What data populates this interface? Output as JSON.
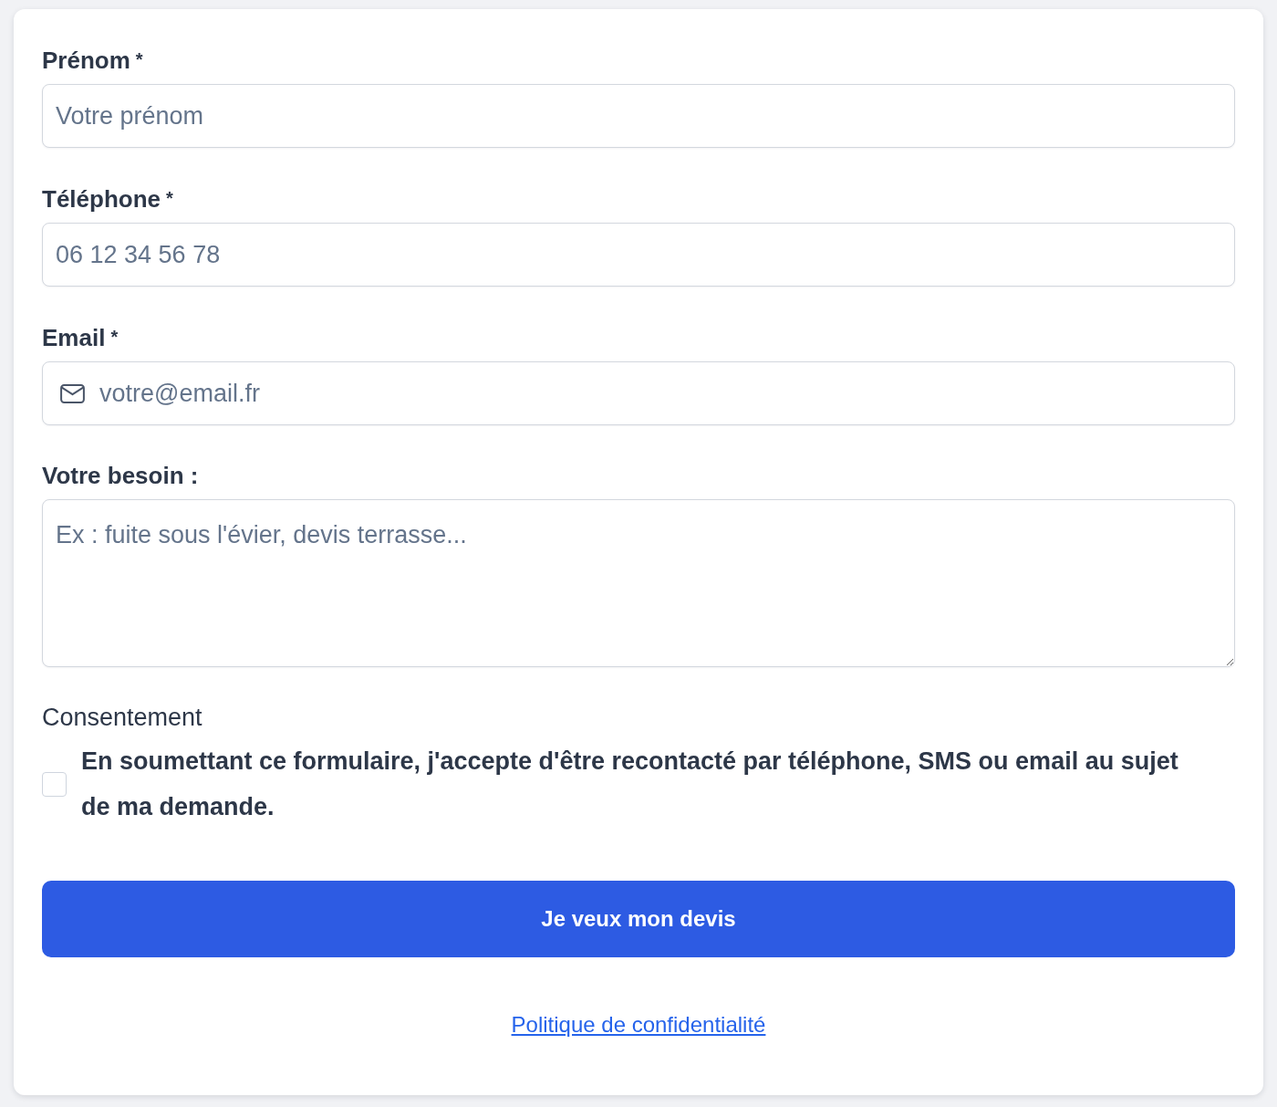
{
  "fields": [
    {
      "kind": "text",
      "label": "Prénom",
      "required_mark": "*",
      "placeholder": "Votre prénom"
    },
    {
      "kind": "tel",
      "label": "Téléphone",
      "required_mark": "*",
      "placeholder": "06 12 34 56 78"
    },
    {
      "kind": "email",
      "label": "Email",
      "required_mark": "*",
      "placeholder": "votre@email.fr"
    },
    {
      "kind": "textarea",
      "label": "Votre besoin :",
      "placeholder": "Ex : fuite sous l'évier, devis terrasse..."
    }
  ],
  "consent": {
    "heading": "Consentement",
    "checked": false,
    "text": "En soumettant ce formulaire, j'accepte d'être recontacté par téléphone, SMS ou email au sujet de ma demande."
  },
  "submit_button": {
    "label": "Je veux mon devis"
  },
  "privacy_link": {
    "label": "Politique de confidentialité"
  }
}
